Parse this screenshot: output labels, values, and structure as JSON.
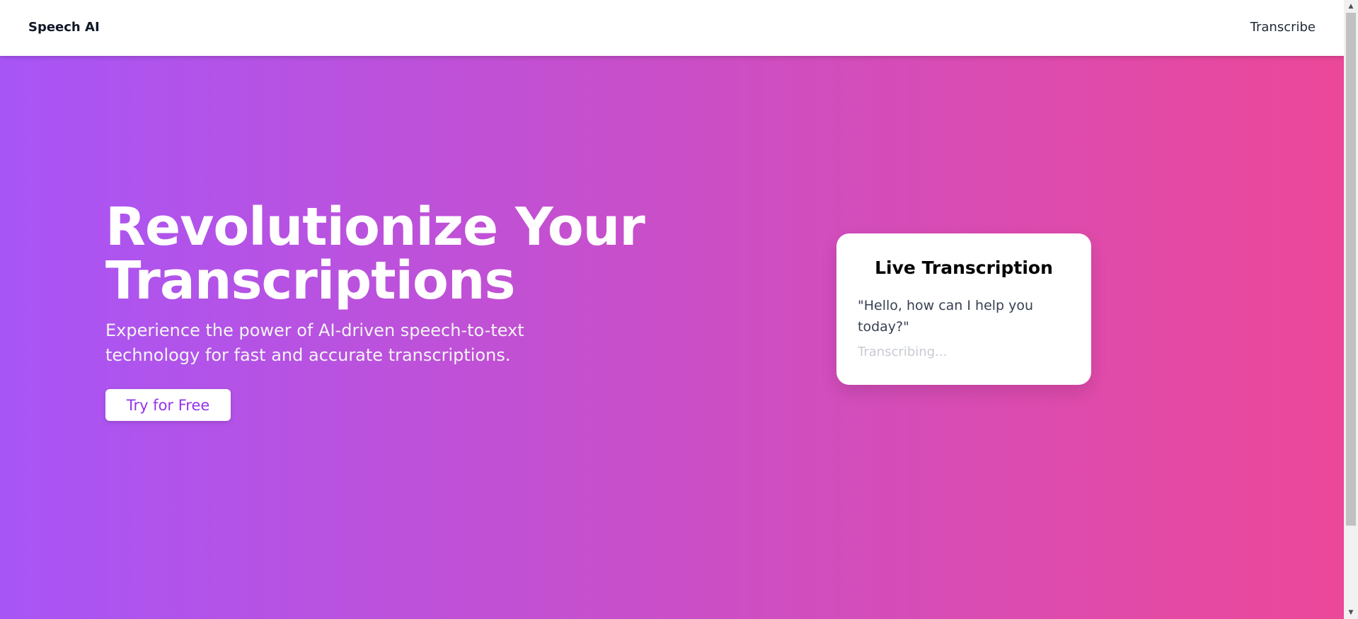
{
  "navbar": {
    "brand": "Speech AI",
    "links": [
      {
        "label": "Transcribe"
      }
    ]
  },
  "hero": {
    "title": "Revolutionize Your Transcriptions",
    "subtitle": "Experience the power of AI-driven speech-to-text technology for fast and accurate transcriptions.",
    "cta_label": "Try for Free",
    "gradient_start": "#a855f7",
    "gradient_end": "#ec4899"
  },
  "live_card": {
    "title": "Live Transcription",
    "quote": "\"Hello, how can I help you today?\"",
    "status": "Transcribing..."
  },
  "scrollbar": {
    "up_icon": "triangle-up-icon",
    "down_icon": "triangle-down-icon"
  }
}
